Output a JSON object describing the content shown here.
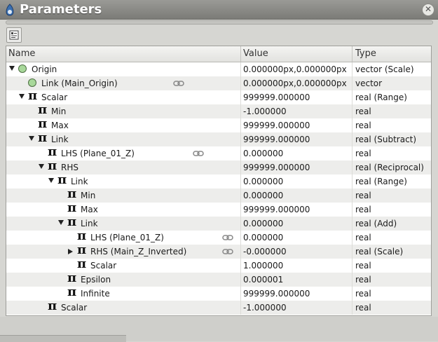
{
  "window": {
    "title": "Parameters"
  },
  "columns": {
    "name": "Name",
    "value": "Value",
    "type": "Type"
  },
  "rows": [
    {
      "name": "Origin",
      "value": "0.000000px,0.000000px",
      "type": "vector (Scale)",
      "depth": 0,
      "expander": "down",
      "icon": "green-dot-icon",
      "linked": false
    },
    {
      "name": "Link (Main_Origin)",
      "value": "0.000000px,0.000000px",
      "type": "vector",
      "depth": 1,
      "expander": "none",
      "icon": "green-dot-icon",
      "linked": true
    },
    {
      "name": "Scalar",
      "value": "999999.000000",
      "type": "real (Range)",
      "depth": 1,
      "expander": "down",
      "icon": "pi-icon",
      "linked": false
    },
    {
      "name": "Min",
      "value": "-1.000000",
      "type": "real",
      "depth": 2,
      "expander": "none",
      "icon": "pi-icon",
      "linked": false
    },
    {
      "name": "Max",
      "value": "999999.000000",
      "type": "real",
      "depth": 2,
      "expander": "none",
      "icon": "pi-icon",
      "linked": false
    },
    {
      "name": "Link",
      "value": "999999.000000",
      "type": "real (Subtract)",
      "depth": 2,
      "expander": "down",
      "icon": "pi-icon",
      "linked": false
    },
    {
      "name": "LHS (Plane_01_Z)",
      "value": "0.000000",
      "type": "real",
      "depth": 3,
      "expander": "none",
      "icon": "pi-icon",
      "linked": true
    },
    {
      "name": "RHS",
      "value": "999999.000000",
      "type": "real (Reciprocal)",
      "depth": 3,
      "expander": "down",
      "icon": "pi-icon",
      "linked": false
    },
    {
      "name": "Link",
      "value": "0.000000",
      "type": "real (Range)",
      "depth": 4,
      "expander": "down",
      "icon": "pi-icon",
      "linked": false
    },
    {
      "name": "Min",
      "value": "0.000000",
      "type": "real",
      "depth": 5,
      "expander": "none",
      "icon": "pi-icon",
      "linked": false
    },
    {
      "name": "Max",
      "value": "999999.000000",
      "type": "real",
      "depth": 5,
      "expander": "none",
      "icon": "pi-icon",
      "linked": false
    },
    {
      "name": "Link",
      "value": "0.000000",
      "type": "real (Add)",
      "depth": 5,
      "expander": "down",
      "icon": "pi-icon",
      "linked": false
    },
    {
      "name": "LHS (Plane_01_Z)",
      "value": "0.000000",
      "type": "real",
      "depth": 6,
      "expander": "none",
      "icon": "pi-icon",
      "linked": true
    },
    {
      "name": "RHS (Main_Z_Inverted)",
      "value": "-0.000000",
      "type": "real (Scale)",
      "depth": 6,
      "expander": "right",
      "icon": "pi-icon",
      "linked": true
    },
    {
      "name": "Scalar",
      "value": "1.000000",
      "type": "real",
      "depth": 6,
      "expander": "none",
      "icon": "pi-icon",
      "linked": false
    },
    {
      "name": "Epsilon",
      "value": "0.000001",
      "type": "real",
      "depth": 5,
      "expander": "none",
      "icon": "pi-icon",
      "linked": false
    },
    {
      "name": "Infinite",
      "value": "999999.000000",
      "type": "real",
      "depth": 5,
      "expander": "none",
      "icon": "pi-icon",
      "linked": false
    },
    {
      "name": "Scalar",
      "value": "-1.000000",
      "type": "real",
      "depth": 3,
      "expander": "none",
      "icon": "pi-icon",
      "linked": false
    }
  ],
  "colors": {
    "alt_row": "#ededeb",
    "dot_fill": "#a8d89a",
    "titlebar": "#8a8a86"
  }
}
